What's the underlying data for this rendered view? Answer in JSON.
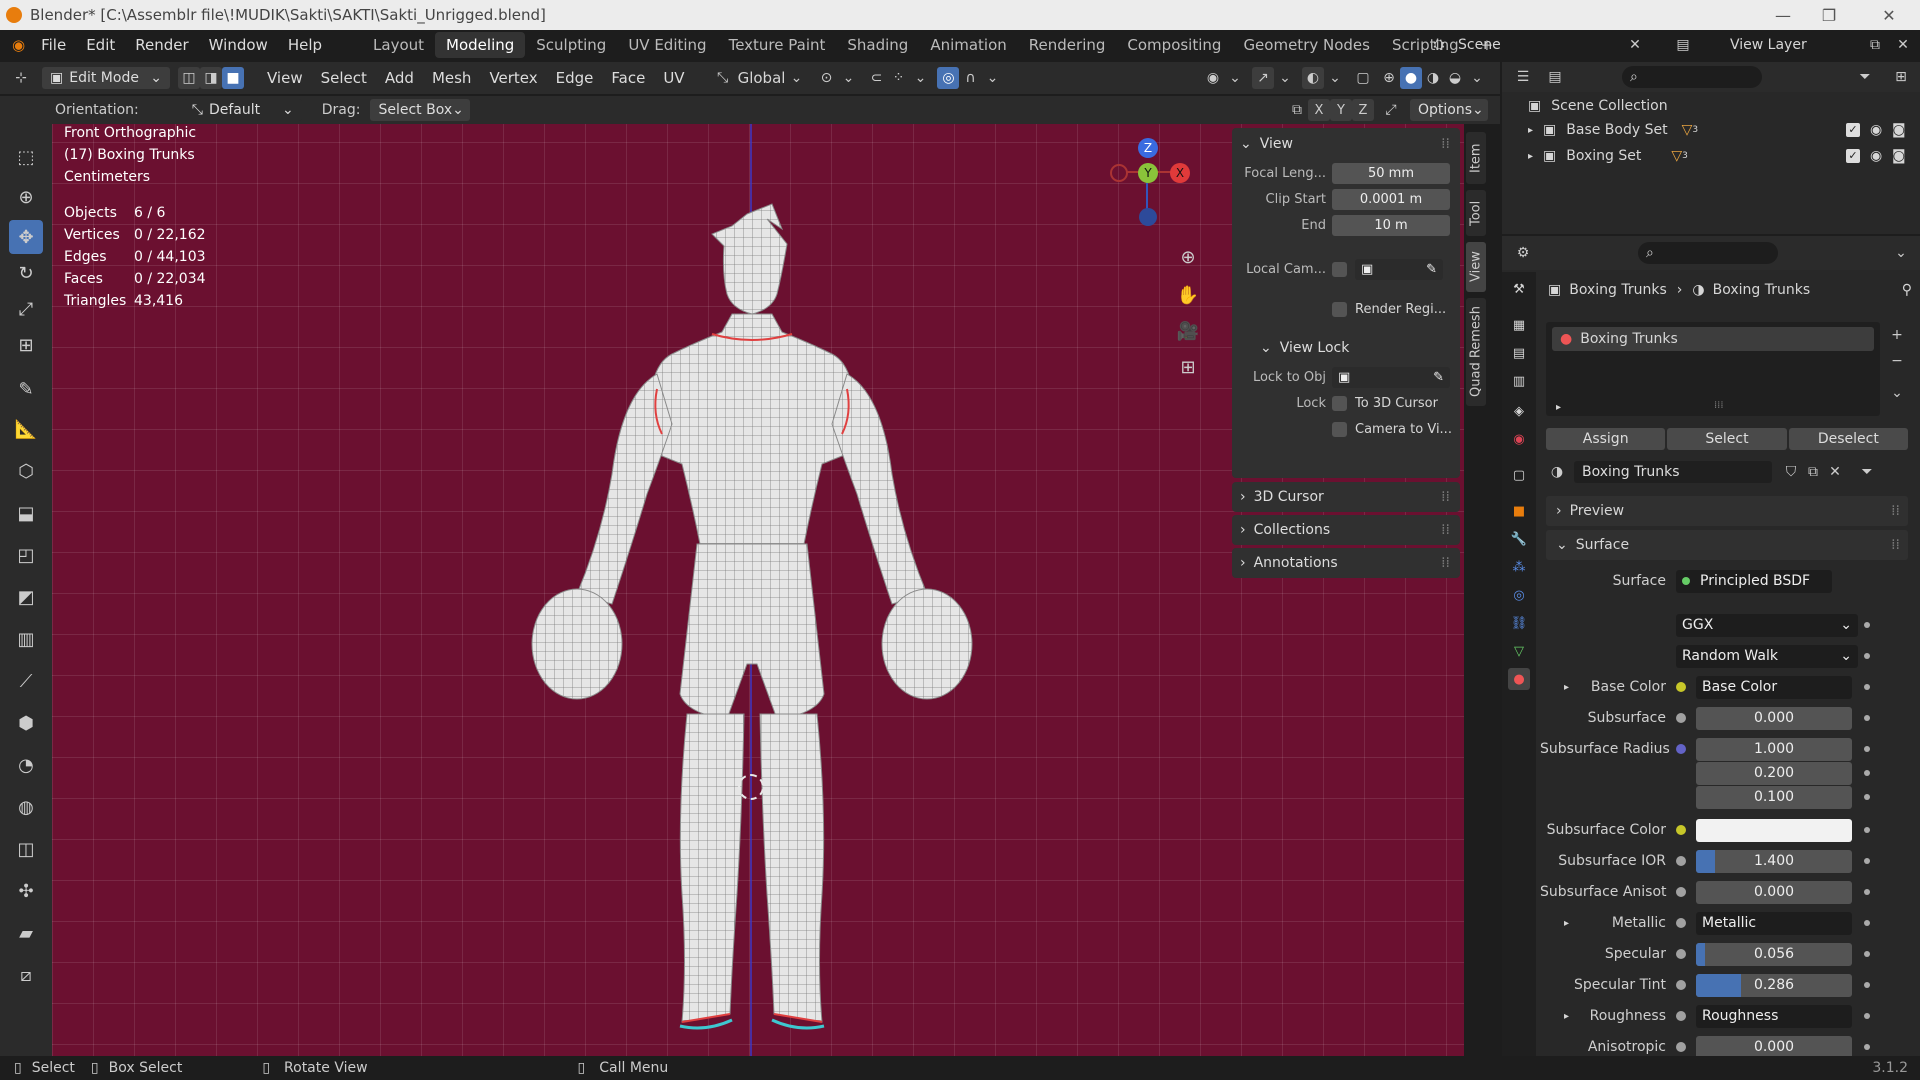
{
  "window": {
    "title": "Blender* [C:\\Assemblr file\\!MUDIK\\Sakti\\SAKTI\\Sakti_Unrigged.blend]"
  },
  "menus": [
    "File",
    "Edit",
    "Render",
    "Window",
    "Help"
  ],
  "workspaces": [
    "Layout",
    "Modeling",
    "Sculpting",
    "UV Editing",
    "Texture Paint",
    "Shading",
    "Animation",
    "Rendering",
    "Compositing",
    "Geometry Nodes",
    "Scripting"
  ],
  "active_workspace": "Modeling",
  "scene": {
    "label": "Scene",
    "view_layer": "View Layer"
  },
  "header": {
    "mode": "Edit Mode",
    "menu": [
      "View",
      "Select",
      "Add",
      "Mesh",
      "Vertex",
      "Edge",
      "Face",
      "UV"
    ],
    "transform_orientation": "Global"
  },
  "subheader": {
    "orientation_label": "Orientation:",
    "orientation_value": "Default",
    "drag_label": "Drag:",
    "drag_value": "Select Box",
    "axes": [
      "X",
      "Y",
      "Z"
    ],
    "options": "Options"
  },
  "viewport": {
    "view_name": "Front Orthographic",
    "object_name": "(17) Boxing Trunks",
    "units": "Centimeters",
    "stats": [
      {
        "label": "Objects",
        "value": "6 / 6"
      },
      {
        "label": "Vertices",
        "value": "0 / 22,162"
      },
      {
        "label": "Edges",
        "value": "0 / 44,103"
      },
      {
        "label": "Faces",
        "value": "0 / 22,034"
      },
      {
        "label": "Triangles",
        "value": "43,416"
      }
    ],
    "gizmo": {
      "z": "Z",
      "y": "Y",
      "x": "X"
    }
  },
  "npanel": {
    "view_title": "View",
    "focal_label": "Focal Leng...",
    "focal_value": "50 mm",
    "clip_start_label": "Clip Start",
    "clip_start_value": "0.0001 m",
    "end_label": "End",
    "end_value": "10 m",
    "local_cam_label": "Local Cam...",
    "render_region": "Render Regi...",
    "view_lock_title": "View Lock",
    "lock_to_obj_label": "Lock to Obj",
    "lock_label": "Lock",
    "to_3d_cursor": "To 3D Cursor",
    "camera_to_view": "Camera to Vi...",
    "collapsed": [
      "3D Cursor",
      "Collections",
      "Annotations"
    ]
  },
  "vertical_tabs": [
    "Item",
    "Tool",
    "View",
    "Quad Remesh"
  ],
  "outliner": {
    "root": "Scene Collection",
    "items": [
      {
        "name": "Base Body Set",
        "badge": "3"
      },
      {
        "name": "Boxing Set",
        "badge": "3"
      }
    ]
  },
  "properties": {
    "breadcrumb_object": "Boxing Trunks",
    "breadcrumb_material": "Boxing Trunks",
    "slot_name": "Boxing Trunks",
    "assign": "Assign",
    "select": "Select",
    "deselect": "Deselect",
    "material_name": "Boxing Trunks",
    "preview": "Preview",
    "surface_section": "Surface",
    "surface_label": "Surface",
    "surface_value": "Principled BSDF",
    "distribution": "GGX",
    "subsurface_method": "Random Walk",
    "rows": [
      {
        "label": "Base Color",
        "value": "Base Color",
        "kind": "link",
        "dot": "#c7c729"
      },
      {
        "label": "Subsurface",
        "value": "0.000",
        "kind": "num",
        "dot": "#a1a1a1",
        "fill": 0
      },
      {
        "label": "Subsurface Radius",
        "value": "1.000",
        "kind": "num",
        "dot": "#6363c7",
        "fill": 0
      },
      {
        "label": "",
        "value": "0.200",
        "kind": "num",
        "dot": "",
        "fill": 0
      },
      {
        "label": "",
        "value": "0.100",
        "kind": "num",
        "dot": "",
        "fill": 0
      },
      {
        "label": "Subsurface Color",
        "value": "",
        "kind": "color",
        "dot": "#c7c729"
      },
      {
        "label": "Subsurface IOR",
        "value": "1.400",
        "kind": "num",
        "dot": "#a1a1a1",
        "fill": 0.12
      },
      {
        "label": "Subsurface Anisot",
        "value": "0.000",
        "kind": "num",
        "dot": "#a1a1a1",
        "fill": 0
      },
      {
        "label": "Metallic",
        "value": "Metallic",
        "kind": "link",
        "dot": "#a1a1a1"
      },
      {
        "label": "Specular",
        "value": "0.056",
        "kind": "num",
        "dot": "#a1a1a1",
        "fill": 0.056
      },
      {
        "label": "Specular Tint",
        "value": "0.286",
        "kind": "num",
        "dot": "#a1a1a1",
        "fill": 0.286
      },
      {
        "label": "Roughness",
        "value": "Roughness",
        "kind": "link",
        "dot": "#a1a1a1"
      },
      {
        "label": "Anisotropic",
        "value": "0.000",
        "kind": "num",
        "dot": "#a1a1a1",
        "fill": 0
      }
    ]
  },
  "statusbar": {
    "select": "Select",
    "box_select": "Box Select",
    "rotate_view": "Rotate View",
    "call_menu": "Call Menu",
    "version": "3.1.2"
  },
  "colors": {
    "viewport_bg": "#6b1030",
    "accent": "#4772b3",
    "seam": "#e04040"
  }
}
